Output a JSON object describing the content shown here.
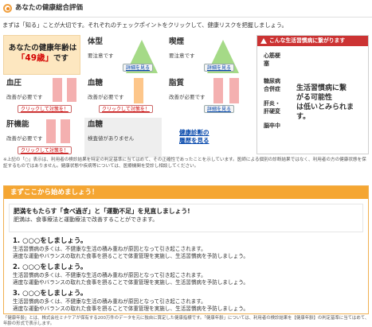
{
  "header": {
    "title": "あなたの健康総合評価"
  },
  "intro": "まずは「知る」ことが大切です。それぞれのチェックポイントをクリックして、健康リスクを把握しましょう。",
  "age_cell": {
    "label_line1": "あなたの健康年齢は",
    "value": "「49歳」",
    "suffix": "です"
  },
  "cells": {
    "body_type": {
      "title": "体型",
      "text": "要注意です",
      "button": "詳細を見る"
    },
    "smoking": {
      "title": "喫煙",
      "text": "要注意です",
      "button": "詳細を見る"
    },
    "blood_pressure": {
      "title": "血圧",
      "text": "改善が必要です",
      "button": "クリックして対策を！"
    },
    "blood_sugar": {
      "title": "血糖",
      "text": "改善が必要です",
      "button": "クリックして対策を！"
    },
    "lipids": {
      "title": "脂質",
      "text": "改善が必要です",
      "button": "詳細を見る"
    },
    "liver": {
      "title": "肝機能",
      "text": "改善が必要です",
      "button": "クリックして対策を！"
    },
    "blood_sugar2": {
      "title": "血糖",
      "text": "検査値がありません"
    }
  },
  "checkup_link": {
    "line1": "健康診断の",
    "line2": "履歴を見る"
  },
  "risk_panel": {
    "header": "こんな生活習慣病に繋がります",
    "diseases": [
      "心筋梗塞",
      "糖尿病合併症",
      "肝炎・肝硬変",
      "脳卒中"
    ],
    "disease_lines": [
      "心筋梗",
      "塞",
      "糖尿病",
      "合併症",
      "肝炎・",
      "肝硬変",
      "脳卒中"
    ],
    "message_lines": [
      "生活習慣病に繋",
      "がる可能性",
      "は低いとみられま",
      "す。"
    ]
  },
  "footnote": "※上記の「○」表示は、利用者の検診結果を特定の判定基準に当てはめて、その正確性であったことを示しています。医師による個別の診断結果ではなく、利用者の方の健康状態を保証するものではありません。健康状態や疾病等については、医療機関を受診し相談してください。",
  "start_box": {
    "header": "まずここから始めましょう！",
    "card_title": "肥満をもたらす「食べ過ぎ」と「運動不足」を見直しましょう!",
    "card_text": "肥満は、食事療法と運動療法で改善することができます。",
    "steps": [
      {
        "title": "1. ○○○をしましょう。",
        "line1": "生活習慣病の多くは、不健康な生活の積み重ねが原因となって引き起こされます。",
        "line2": "適度な運動やバランスの取れた食事を摂ることで体重管理を実施し、生活習慣病を予防しましょう。"
      },
      {
        "title": "2. ○○○をしましょう。",
        "line1": "生活習慣病の多くは、不健康な生活の積み重ねが原因となって引き起こされます。",
        "line2": "適度な運動やバランスの取れた食事を摂ることで体重管理を実施し、生活習慣病を予防しましょう。"
      },
      {
        "title": "3. ○○○をしましょう。",
        "line1": "生活習慣病の多くは、不健康な生活の積み重ねが原因となって引き起こされます。",
        "line2": "適度な運動やバランスの取れた食事を摂ることで体重管理を実施し、生活習慣病を予防しましょう。"
      }
    ]
  },
  "bottom_note": "「健康年齢」とは、株式会社ミナケアが保有する200万件のデータを元に独自に算定した健康指標です。「健康年齢」については、利用者の検診結果を【健康年齢】の判定基準に当てはめて、年齢の形式で表示します。"
}
